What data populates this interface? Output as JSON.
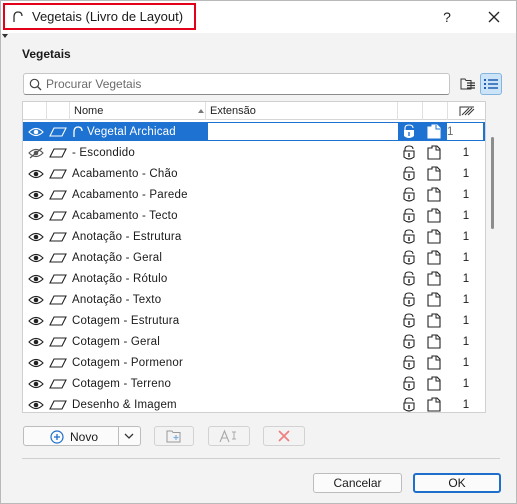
{
  "window": {
    "title": "Vegetais (Livro de Layout)",
    "help_label": "?"
  },
  "panel": {
    "section_title": "Vegetais",
    "search_placeholder": "Procurar Vegetais"
  },
  "table": {
    "columns": [
      "Nome",
      "Extensão"
    ],
    "rows": [
      {
        "name": "Vegetal Archicad",
        "count": "1",
        "visible": true,
        "selected": true,
        "icon": "vegetal-icon"
      },
      {
        "name": "- Escondido",
        "count": "1",
        "visible": false,
        "selected": false
      },
      {
        "name": "Acabamento - Chão",
        "count": "1",
        "visible": true,
        "selected": false
      },
      {
        "name": "Acabamento - Parede",
        "count": "1",
        "visible": true,
        "selected": false
      },
      {
        "name": "Acabamento - Tecto",
        "count": "1",
        "visible": true,
        "selected": false
      },
      {
        "name": "Anotação - Estrutura",
        "count": "1",
        "visible": true,
        "selected": false
      },
      {
        "name": "Anotação - Geral",
        "count": "1",
        "visible": true,
        "selected": false
      },
      {
        "name": "Anotação - Rótulo",
        "count": "1",
        "visible": true,
        "selected": false
      },
      {
        "name": "Anotação - Texto",
        "count": "1",
        "visible": true,
        "selected": false
      },
      {
        "name": "Cotagem - Estrutura",
        "count": "1",
        "visible": true,
        "selected": false
      },
      {
        "name": "Cotagem - Geral",
        "count": "1",
        "visible": true,
        "selected": false
      },
      {
        "name": "Cotagem - Pormenor",
        "count": "1",
        "visible": true,
        "selected": false
      },
      {
        "name": "Cotagem - Terreno",
        "count": "1",
        "visible": true,
        "selected": false
      },
      {
        "name": "Desenho & Imagem",
        "count": "1",
        "visible": true,
        "selected": false
      }
    ]
  },
  "toolbar": {
    "new_label": "Novo"
  },
  "footer": {
    "cancel_label": "Cancelar",
    "ok_label": "OK"
  },
  "colors": {
    "selection": "#1e73d2",
    "accent": "#1e6fcc",
    "title_highlight": "#e3001b",
    "delete": "#e3001b"
  }
}
